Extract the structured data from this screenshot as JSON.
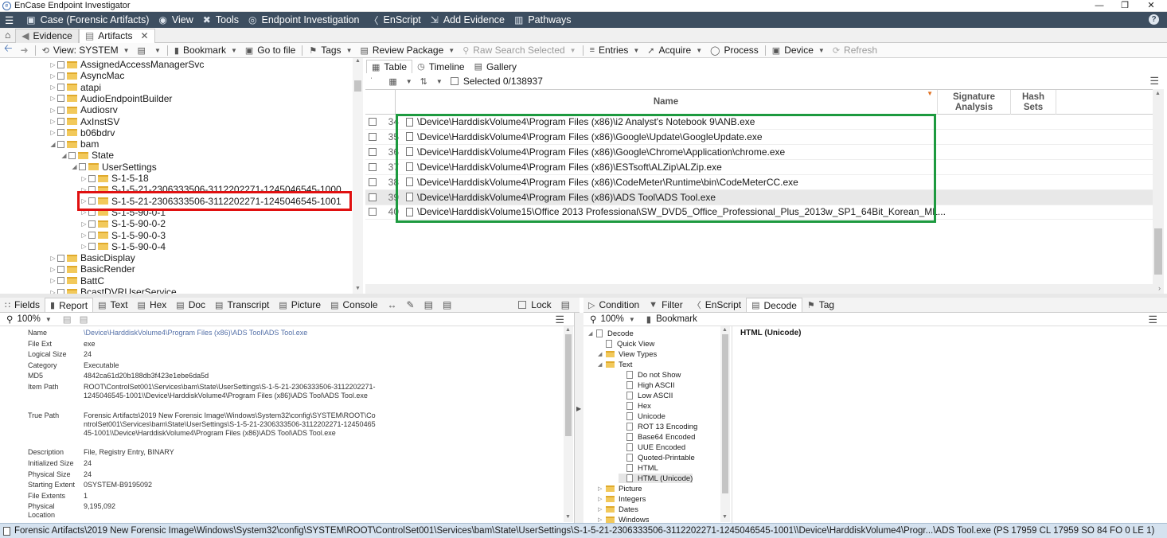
{
  "window": {
    "title": "EnCase Endpoint Investigator"
  },
  "menu": {
    "items": [
      {
        "label": "Case (Forensic Artifacts)",
        "icon": "briefcase-icon",
        "glyph": "▣"
      },
      {
        "label": "View",
        "icon": "eye-icon",
        "glyph": "◉"
      },
      {
        "label": "Tools",
        "icon": "tools-icon",
        "glyph": "✖"
      },
      {
        "label": "Endpoint Investigation",
        "icon": "target-icon",
        "glyph": "◎"
      },
      {
        "label": "EnScript",
        "icon": "script-icon",
        "glyph": "〈"
      },
      {
        "label": "Add Evidence",
        "icon": "add-evidence-icon",
        "glyph": "⇲"
      },
      {
        "label": "Pathways",
        "icon": "pathways-icon",
        "glyph": "▥"
      }
    ]
  },
  "tabs": [
    {
      "label": "Evidence"
    },
    {
      "label": "Artifacts"
    }
  ],
  "toolbar": {
    "view": "View: SYSTEM",
    "bookmark": "Bookmark",
    "goto": "Go to file",
    "tags": "Tags",
    "review": "Review Package",
    "raw": "Raw Search Selected",
    "entries": "Entries",
    "acquire": "Acquire",
    "process": "Process",
    "device": "Device",
    "refresh": "Refresh"
  },
  "tree": [
    {
      "label": "AssignedAccessManagerSvc",
      "indent": 0
    },
    {
      "label": "AsyncMac",
      "indent": 0
    },
    {
      "label": "atapi",
      "indent": 0
    },
    {
      "label": "AudioEndpointBuilder",
      "indent": 0
    },
    {
      "label": "Audiosrv",
      "indent": 0
    },
    {
      "label": "AxInstSV",
      "indent": 0
    },
    {
      "label": "b06bdrv",
      "indent": 0
    },
    {
      "label": "bam",
      "indent": 0
    },
    {
      "label": "State",
      "indent": 1
    },
    {
      "label": "UserSettings",
      "indent": 2
    },
    {
      "label": "S-1-5-18",
      "indent": 3
    },
    {
      "label": "S-1-5-21-2306333506-3112202271-1245046545-1000",
      "indent": 3
    },
    {
      "label": "S-1-5-21-2306333506-3112202271-1245046545-1001",
      "indent": 3
    },
    {
      "label": "S-1-5-90-0-1",
      "indent": 3
    },
    {
      "label": "S-1-5-90-0-2",
      "indent": 3
    },
    {
      "label": "S-1-5-90-0-3",
      "indent": 3
    },
    {
      "label": "S-1-5-90-0-4",
      "indent": 3
    },
    {
      "label": "BasicDisplay",
      "indent": 0
    },
    {
      "label": "BasicRender",
      "indent": 0
    },
    {
      "label": "BattC",
      "indent": 0
    },
    {
      "label": "BcastDVRUserService",
      "indent": 0
    }
  ],
  "viewtabs": [
    {
      "label": "Table"
    },
    {
      "label": "Timeline"
    },
    {
      "label": "Gallery"
    }
  ],
  "selected": "Selected 0/138937",
  "columns": {
    "name": "Name",
    "sig": "Signature Analysis",
    "hash": "Hash Sets"
  },
  "rows": [
    {
      "num": "34",
      "name": "\\Device\\HarddiskVolume4\\Program Files (x86)\\i2 Analyst's Notebook 9\\ANB.exe"
    },
    {
      "num": "35",
      "name": "\\Device\\HarddiskVolume4\\Program Files (x86)\\Google\\Update\\GoogleUpdate.exe"
    },
    {
      "num": "36",
      "name": "\\Device\\HarddiskVolume4\\Program Files (x86)\\Google\\Chrome\\Application\\chrome.exe"
    },
    {
      "num": "37",
      "name": "\\Device\\HarddiskVolume4\\Program Files (x86)\\ESTsoft\\ALZip\\ALZip.exe"
    },
    {
      "num": "38",
      "name": "\\Device\\HarddiskVolume4\\Program Files (x86)\\CodeMeter\\Runtime\\bin\\CodeMeterCC.exe"
    },
    {
      "num": "39",
      "name": "\\Device\\HarddiskVolume4\\Program Files (x86)\\ADS Tool\\ADS Tool.exe"
    },
    {
      "num": "40",
      "name": "\\Device\\HarddiskVolume15\\Office 2013 Professional\\SW_DVD5_Office_Professional_Plus_2013w_SP1_64Bit_Korean_ML..."
    }
  ],
  "bottomtabs": [
    {
      "label": "Fields"
    },
    {
      "label": "Report"
    },
    {
      "label": "Text"
    },
    {
      "label": "Hex"
    },
    {
      "label": "Doc"
    },
    {
      "label": "Transcript"
    },
    {
      "label": "Picture"
    },
    {
      "label": "Console"
    }
  ],
  "lock": "Lock",
  "decodetabs": [
    {
      "label": "Condition"
    },
    {
      "label": "Filter"
    },
    {
      "label": "EnScript"
    },
    {
      "label": "Decode"
    },
    {
      "label": "Tag"
    }
  ],
  "zoom": "100%",
  "decodebookmark": "Bookmark",
  "report": [
    {
      "k": "Name",
      "v": "\\Device\\HarddiskVolume4\\Program Files (x86)\\ADS Tool\\ADS Tool.exe",
      "link": true
    },
    {
      "k": "File Ext",
      "v": "exe"
    },
    {
      "k": "Logical Size",
      "v": "24"
    },
    {
      "k": "Category",
      "v": "Executable"
    },
    {
      "k": "MD5",
      "v": "4842ca61d20b188db3f423e1ebe6da5d"
    },
    {
      "k": "Item Path",
      "v": "ROOT\\ControlSet001\\Services\\bam\\State\\UserSettings\\S-1-5-21-2306333506-3112202271-1245046545-1001\\\\Device\\HarddiskVolume4\\Program Files (x86)\\ADS Tool\\ADS Tool.exe"
    },
    {
      "k": "True Path",
      "v": "Forensic Artifacts\\2019 New Forensic Image\\Windows\\System32\\config\\SYSTEM\\ROOT\\ControlSet001\\Services\\bam\\State\\UserSettings\\S-1-5-21-2306333506-3112202271-1245046545-1001\\\\Device\\HarddiskVolume4\\Program Files (x86)\\ADS Tool\\ADS Tool.exe"
    },
    {
      "k": "Description",
      "v": "File, Registry Entry, BINARY"
    },
    {
      "k": "Initialized Size",
      "v": "24"
    },
    {
      "k": "Physical Size",
      "v": "24"
    },
    {
      "k": "Starting Extent",
      "v": "0SYSTEM-B9195092"
    },
    {
      "k": "File Extents",
      "v": "1"
    },
    {
      "k": "Physical Location",
      "v": "9,195,092"
    }
  ],
  "decodetree": [
    {
      "label": "Decode",
      "kind": "page",
      "indent": 0
    },
    {
      "label": "Quick View",
      "kind": "page",
      "indent": 1
    },
    {
      "label": "View Types",
      "kind": "folder",
      "indent": 1
    },
    {
      "label": "Text",
      "kind": "folder",
      "indent": 2
    },
    {
      "label": "Do not Show",
      "kind": "page",
      "indent": 3
    },
    {
      "label": "High ASCII",
      "kind": "page",
      "indent": 3
    },
    {
      "label": "Low ASCII",
      "kind": "page",
      "indent": 3
    },
    {
      "label": "Hex",
      "kind": "page",
      "indent": 3
    },
    {
      "label": "Unicode",
      "kind": "page",
      "indent": 3
    },
    {
      "label": "ROT 13 Encoding",
      "kind": "page",
      "indent": 3
    },
    {
      "label": "Base64 Encoded",
      "kind": "page",
      "indent": 3
    },
    {
      "label": "UUE Encoded",
      "kind": "page",
      "indent": 3
    },
    {
      "label": "Quoted-Printable",
      "kind": "page",
      "indent": 3
    },
    {
      "label": "HTML",
      "kind": "page",
      "indent": 3
    },
    {
      "label": "HTML (Unicode)",
      "kind": "page",
      "indent": 3
    },
    {
      "label": "Picture",
      "kind": "folder",
      "indent": 2
    },
    {
      "label": "Integers",
      "kind": "folder",
      "indent": 2
    },
    {
      "label": "Dates",
      "kind": "folder",
      "indent": 2
    },
    {
      "label": "Windows",
      "kind": "folder",
      "indent": 2
    }
  ],
  "decodeoutput": "HTML (Unicode)",
  "status": "Forensic Artifacts\\2019 New Forensic Image\\Windows\\System32\\config\\SYSTEM\\ROOT\\ControlSet001\\Services\\bam\\State\\UserSettings\\S-1-5-21-2306333506-3112202271-1245046545-1001\\\\Device\\HarddiskVolume4\\Progr...\\ADS Tool.exe (PS 17959 CL 17959 SO 84 FO 0 LE 1)"
}
